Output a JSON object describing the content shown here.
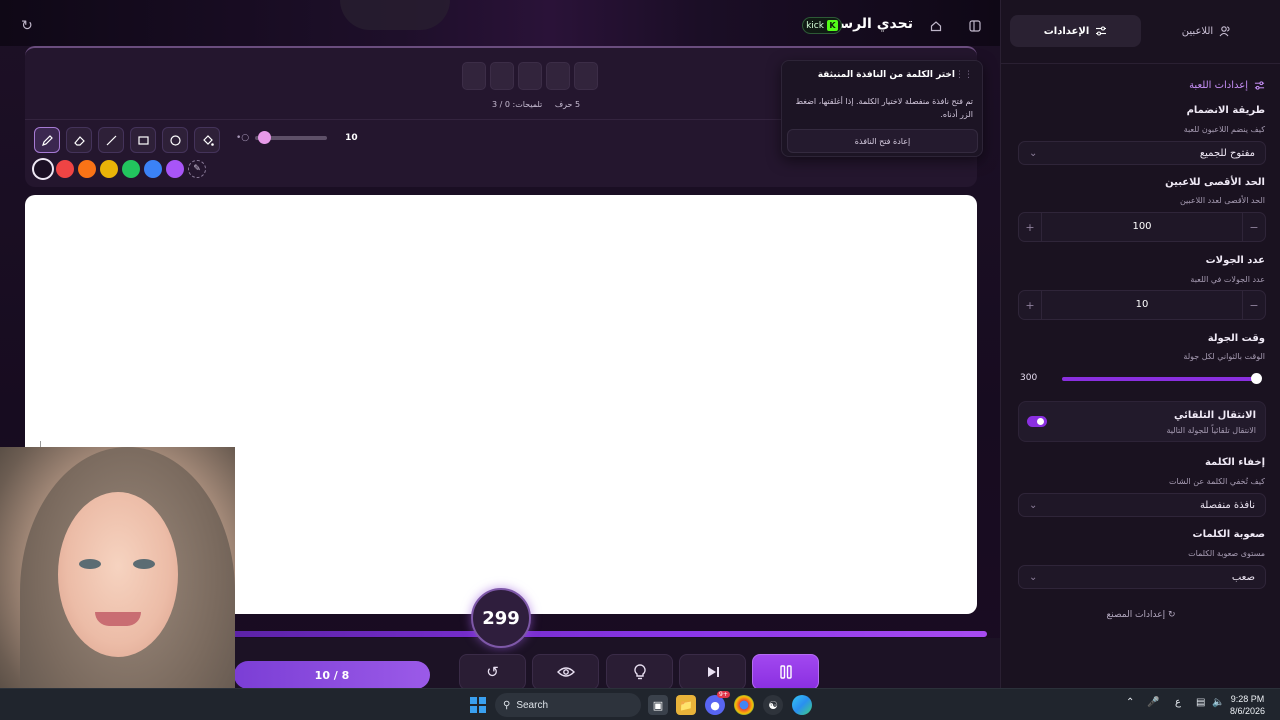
{
  "header": {
    "title": "تحدي الرسم",
    "kick_label": "kick"
  },
  "word_panel": {
    "letters_label": "5 حرف",
    "hints_label": "تلميحات: 0 / 3"
  },
  "toolbar": {
    "tools": [
      "pen",
      "eraser",
      "line",
      "rectangle",
      "circle",
      "fill"
    ],
    "brush_size": "10",
    "colors": [
      "#1b1024",
      "#ef4444",
      "#f97316",
      "#eab308",
      "#22c55e",
      "#3b82f6",
      "#a855f7"
    ],
    "selected_color": "#1b1024"
  },
  "notice": {
    "title": "اختر الكلمة من النافذة المنبثقة",
    "body": "تم فتح نافذة منفصلة لاختيار الكلمة. إذا أغلقتها، اضغط الزر أدناه.",
    "reopen_button": "إعادة فتح النافذة"
  },
  "game": {
    "timer": "299",
    "round": "10 / 8"
  },
  "sidebar": {
    "tabs": {
      "players": "اللاعبين",
      "settings": "الإعدادات"
    },
    "section_title": "إعدادات اللعبة",
    "join_mode": {
      "label": "طريقة الانضمام",
      "desc": "كيف ينضم اللاعبون للعبة",
      "value": "مفتوح للجميع"
    },
    "max_players": {
      "label": "الحد الأقصى للاعبين",
      "desc": "الحد الأقصى لعدد اللاعبين",
      "value": "100"
    },
    "rounds": {
      "label": "عدد الجولات",
      "desc": "عدد الجولات في اللعبة",
      "value": "10"
    },
    "round_time": {
      "label": "وقت الجولة",
      "desc": "الوقت بالثواني لكل جولة",
      "value": "300"
    },
    "auto_advance": {
      "label": "الانتقال التلقائي",
      "desc": "الانتقال تلقائياً للجولة التالية",
      "enabled": true
    },
    "hide_word": {
      "label": "إخفاء الكلمة",
      "desc": "كيف تُخفي الكلمة عن الشات",
      "value": "نافذة منفصلة"
    },
    "difficulty": {
      "label": "صعوبة الكلمات",
      "desc": "مستوى صعوبة الكلمات",
      "value": "صعب"
    },
    "factory_reset": "إعدادات المصنع"
  },
  "taskbar": {
    "search_placeholder": "Search",
    "discord_badge": "9+",
    "language": "ع",
    "time": "9:28 PM",
    "date": "8/6/2026"
  }
}
